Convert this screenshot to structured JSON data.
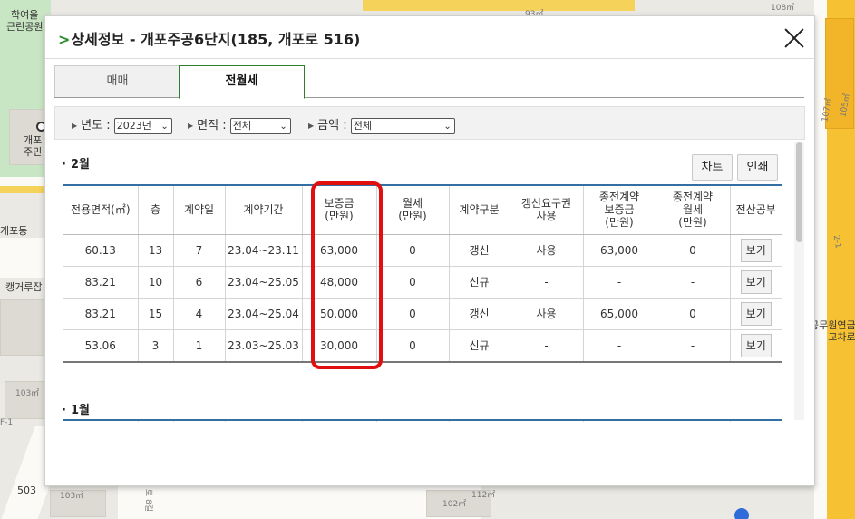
{
  "map": {
    "labels": {
      "park": "학여울\n근린공원",
      "poi": "개포\n주민",
      "l1": "개포동",
      "l2": "캥거루잡",
      "l3": "공무원연금\n교차로",
      "n1": "108㎡",
      "n2": "93㎡",
      "n3": "103㎡",
      "n4": "503",
      "n5": "103㎡",
      "n6": "102㎡",
      "n7": "112㎡",
      "n8": "107㎡",
      "n9": "105㎡",
      "road": "로 8길",
      "r1": "F-1",
      "r2": "2-1"
    }
  },
  "dialog": {
    "title_prefix": ">",
    "title": "상세정보 - 개포주공6단지(185, 개포로 516)",
    "tabs": [
      "매매",
      "전월세"
    ],
    "active_tab": "전월세",
    "filters": {
      "year_label": "년도 :",
      "year_value": "2023년",
      "area_label": "면적 :",
      "area_value": "전체",
      "amount_label": "금액 :",
      "amount_value": "전체"
    },
    "buttons": {
      "chart": "차트",
      "print": "인쇄",
      "view": "보기"
    },
    "columns": [
      "전용면적(㎡)",
      "층",
      "계약일",
      "계약기간",
      "보증금\n(만원)",
      "월세\n(만원)",
      "계약구분",
      "갱신요구권\n사용",
      "종전계약\n보증금\n(만원)",
      "종전계약\n월세\n(만원)",
      "전산공부"
    ],
    "months": [
      {
        "label": "2월",
        "rows": [
          [
            "60.13",
            "13",
            "7",
            "23.04~23.11",
            "63,000",
            "0",
            "갱신",
            "사용",
            "63,000",
            "0"
          ],
          [
            "83.21",
            "10",
            "6",
            "23.04~25.05",
            "48,000",
            "0",
            "신규",
            "-",
            "-",
            "-"
          ],
          [
            "83.21",
            "15",
            "4",
            "23.04~25.04",
            "50,000",
            "0",
            "갱신",
            "사용",
            "65,000",
            "0"
          ],
          [
            "53.06",
            "3",
            "1",
            "23.03~25.03",
            "30,000",
            "0",
            "신규",
            "-",
            "-",
            "-"
          ]
        ]
      },
      {
        "label": "1월",
        "rows": []
      }
    ]
  }
}
